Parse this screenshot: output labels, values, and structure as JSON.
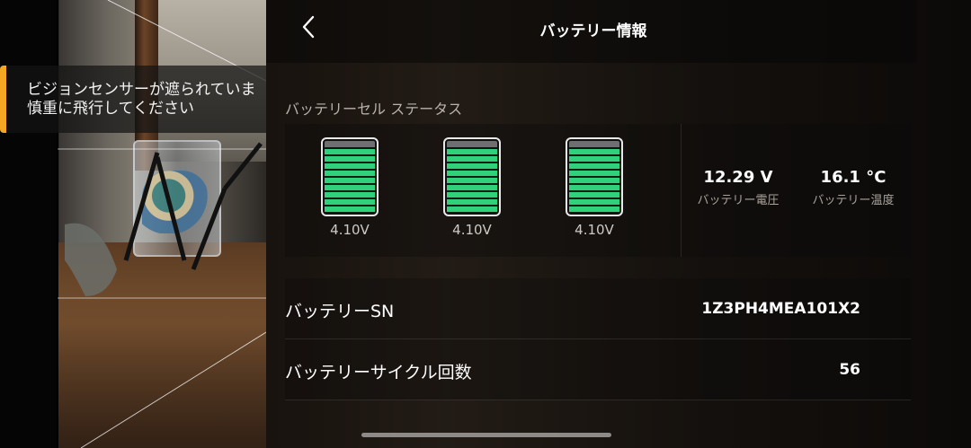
{
  "warning": {
    "line1": "ビジョンセンサーが遮られていま",
    "line2": "慎重に飛行してください",
    "accent_color": "#f5a623"
  },
  "header": {
    "back_icon": "chevron-left-icon",
    "title": "バッテリー情報"
  },
  "cell_status": {
    "section_label": "バッテリーセル ステータス",
    "cells": [
      {
        "voltage": "4.10V"
      },
      {
        "voltage": "4.10V"
      },
      {
        "voltage": "4.10V"
      }
    ],
    "cell_fill_color": "#2fd27a"
  },
  "stats": {
    "voltage": {
      "value": "12.29 V",
      "label": "バッテリー電圧"
    },
    "temperature": {
      "value": "16.1 °C",
      "label": "バッテリー温度"
    }
  },
  "details": {
    "serial": {
      "label": "バッテリーSN",
      "value": "1Z3PH4MEA101X2"
    },
    "cycles": {
      "label": "バッテリーサイクル回数",
      "value": "56"
    }
  }
}
